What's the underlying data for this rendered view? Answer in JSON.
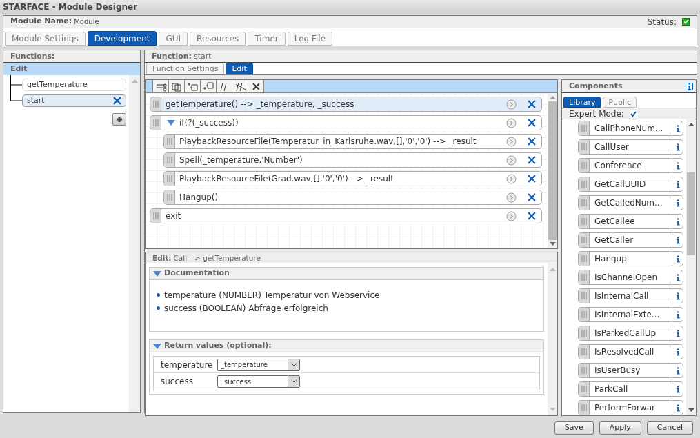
{
  "window": {
    "title": "STARFACE - Module Designer"
  },
  "module": {
    "label": "Module Name:",
    "value": "Module",
    "status_label": "Status:",
    "status_ok": true
  },
  "tabs": [
    {
      "label": "Module Settings",
      "selected": false
    },
    {
      "label": "Development",
      "selected": true
    },
    {
      "label": "GUI",
      "selected": false
    },
    {
      "label": "Resources",
      "selected": false
    },
    {
      "label": "Timer",
      "selected": false
    },
    {
      "label": "Log File",
      "selected": false
    }
  ],
  "functions": {
    "title": "Functions:",
    "header": "Edit",
    "items": [
      {
        "label": "getTemperature",
        "selected": false
      },
      {
        "label": "start",
        "selected": true
      }
    ]
  },
  "function": {
    "label": "Function:",
    "name": "start"
  },
  "subtabs": [
    {
      "label": "Function Settings",
      "selected": false
    },
    {
      "label": "Edit",
      "selected": true
    }
  ],
  "toolbar": [
    {
      "kind": "cut"
    },
    {
      "kind": "copy"
    },
    {
      "kind": "insert-before"
    },
    {
      "kind": "insert-after"
    },
    {
      "kind": "comment"
    },
    {
      "kind": "uncomment"
    },
    {
      "kind": "delete"
    }
  ],
  "statements": [
    {
      "text": "getTemperature() --> _temperature, _success",
      "selected": true
    },
    {
      "text": "if(?(_success))",
      "selected": false,
      "expanded": true,
      "children": [
        {
          "text": "PlaybackResourceFile(Temperatur_in_Karlsruhe.wav,[],'0','0') --> _result",
          "selected": false
        },
        {
          "text": "Spell(_temperature,'Number')",
          "selected": false
        },
        {
          "text": "PlaybackResourceFile(Grad.wav,[],'0','0') --> _result",
          "selected": false
        },
        {
          "text": "Hangup()",
          "selected": false
        }
      ]
    },
    {
      "text": "exit",
      "selected": false
    }
  ],
  "edit": {
    "label": "Edit:",
    "value": "Call --> getTemperature",
    "documentation": {
      "title": "Documentation",
      "expanded": true,
      "items": [
        "temperature (NUMBER) Temperatur von Webservice",
        "success (BOOLEAN) Abfrage erfolgreich"
      ]
    },
    "return_values": {
      "title": "Return values (optional):",
      "expanded": true,
      "rows": [
        {
          "name": "temperature",
          "value": "_temperature"
        },
        {
          "name": "success",
          "value": "_success"
        }
      ]
    }
  },
  "components": {
    "title": "Components",
    "tabs": [
      {
        "label": "Library",
        "selected": true
      },
      {
        "label": "Public",
        "selected": false
      }
    ],
    "expert_mode_label": "Expert Mode:",
    "expert_mode": true,
    "items": [
      "CallPhoneNum...",
      "CallUser",
      "Conference",
      "GetCallUUID",
      "GetCalledNum...",
      "GetCallee",
      "GetCaller",
      "Hangup",
      "IsChannelOpen",
      "IsInternalCall",
      "IsInternalExte...",
      "IsParkedCallUp",
      "IsResolvedCall",
      "IsUserBusy",
      "ParkCall",
      "PerformForwar"
    ]
  },
  "buttons": [
    "Save",
    "Apply",
    "Cancel"
  ]
}
